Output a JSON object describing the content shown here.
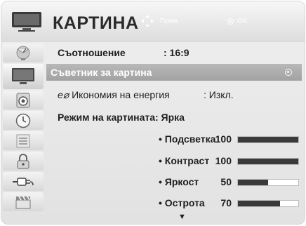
{
  "header": {
    "title": "КАРТИНА",
    "hint_move": "Прем.",
    "hint_ok": "OK",
    "icon": "tv-icon"
  },
  "sidebar": {
    "items": [
      {
        "icon": "satellite-dish-icon",
        "active": false
      },
      {
        "icon": "tv-screen-icon",
        "active": true
      },
      {
        "icon": "speaker-icon",
        "active": false
      },
      {
        "icon": "clock-icon",
        "active": false
      },
      {
        "icon": "options-icon",
        "active": false
      },
      {
        "icon": "lock-icon",
        "active": false
      },
      {
        "icon": "input-plug-icon",
        "active": false
      },
      {
        "icon": "clapperboard-icon",
        "active": false
      }
    ]
  },
  "menu": {
    "aspect": {
      "label": "Съотношение",
      "value": ": 16:9"
    },
    "wizard": {
      "label": "Съветник за картина"
    },
    "energy": {
      "icon_text": "e⌀",
      "label": "Икономия на енергия",
      "value": ": Изкл."
    },
    "mode": {
      "label": "Режим на картината: Ярка"
    },
    "adjustments": [
      {
        "label": "• Подсветка",
        "value": "100",
        "level": 1.0
      },
      {
        "label": "• Контраст",
        "value": "100",
        "level": 1.0
      },
      {
        "label": "• Яркост",
        "value": "50",
        "level": 0.5
      },
      {
        "label": "• Острота",
        "value": "70",
        "level": 0.7
      }
    ],
    "more_arrow": "▼"
  }
}
